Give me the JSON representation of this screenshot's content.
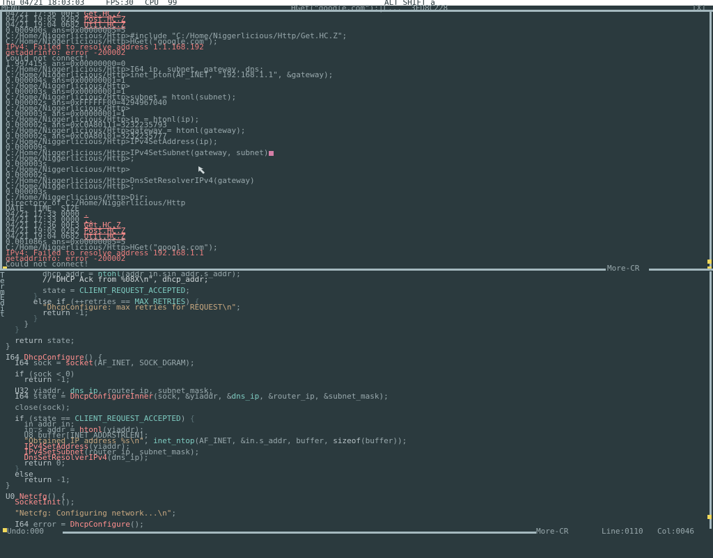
{
  "topbar": {
    "clock": "Thu 04/21 18:03:03",
    "fps": "FPS:30",
    "cpu": "CPU  99",
    "keystate": "ALT SHIFT a"
  },
  "titlebar": {
    "menu": "MENU",
    "title": "HGet(\"google.com\");|L...  3FD8C228",
    "close": "[X]"
  },
  "terminal": {
    "lines": [
      [
        {
          "c": "t-norm",
          "t": "04/21 17:36 00F3 "
        },
        {
          "c": "t-link",
          "t": "Get.HC.Z"
        }
      ],
      [
        {
          "c": "t-norm",
          "t": "04/21 19:05 02B2 "
        },
        {
          "c": "t-link",
          "t": "Post.HC.Z"
        }
      ],
      [
        {
          "c": "t-norm",
          "t": "04/21 19:04 0682 "
        },
        {
          "c": "t-link",
          "t": "Util.HC.Z"
        }
      ],
      [
        {
          "c": "t-norm",
          "t": "0.000900s ans=0x00000005=5"
        }
      ],
      [
        {
          "c": "t-norm",
          "t": "C:/Home/Niggerlicious/Http>#include \"C:/Home/Niggerlicious/Http/Get.HC.Z\";"
        }
      ],
      [
        {
          "c": "t-norm",
          "t": "C:/Home/Niggerlicious/Http>HGet(\"google.com\");"
        }
      ],
      [
        {
          "c": "t-err",
          "t": "IPv4: Failed to resolve address 1.1.168.192"
        }
      ],
      [
        {
          "c": "t-err",
          "t": "getaddrinfo: error -200002"
        }
      ],
      [
        {
          "c": "t-norm",
          "t": "Could not connect!"
        }
      ],
      [
        {
          "c": "t-norm",
          "t": "1.997415s ans=0x00000000=0"
        }
      ],
      [
        {
          "c": "t-norm",
          "t": "C:/Home/Niggerlicious/Http>I64 ip, subnet, gateway, dns;"
        }
      ],
      [
        {
          "c": "t-norm",
          "t": "C:/Home/Niggerlicious/Http>inet_pton(AF_INET, \"192.168.1.1\", &gateway);"
        }
      ],
      [
        {
          "c": "t-norm",
          "t": "0.000004s ans=0x00000001=1"
        }
      ],
      [
        {
          "c": "t-norm",
          "t": "C:/Home/Niggerlicious/Http>"
        }
      ],
      [
        {
          "c": "t-norm",
          "t": "0.000003s ans=0x00000001=1"
        }
      ],
      [
        {
          "c": "t-norm",
          "t": "C:/Home/Niggerlicious/Http>subnet = htonl(subnet);"
        }
      ],
      [
        {
          "c": "t-norm",
          "t": "0.000002s ans=0xFFFFFF00=4294967040"
        }
      ],
      [
        {
          "c": "t-norm",
          "t": "C:/Home/Niggerlicious/Http>"
        }
      ],
      [
        {
          "c": "t-norm",
          "t": "0.000003s ans=0x00000001=1"
        }
      ],
      [
        {
          "c": "t-norm",
          "t": "C:/Home/Niggerlicious/Http>ip = htonl(ip);"
        }
      ],
      [
        {
          "c": "t-norm",
          "t": "0.000002s ans=0xC0A80111=3232235793"
        }
      ],
      [
        {
          "c": "t-norm",
          "t": "C:/Home/Niggerlicious/Http>gateway = htonl(gateway);"
        }
      ],
      [
        {
          "c": "t-norm",
          "t": "0.000002s ans=0xC0A80101=3232235777"
        }
      ],
      [
        {
          "c": "t-norm",
          "t": "C:/Home/Niggerlicious/Http>IPv4SetAddress(ip);"
        }
      ],
      [
        {
          "c": "t-norm",
          "t": "0.000009s"
        }
      ],
      [
        {
          "c": "t-norm",
          "t": "C:/Home/Niggerlicious/Http>IPv4SetSubnet(gateway, subnet)"
        },
        {
          "c": "cursor",
          "t": ""
        }
      ],
      [
        {
          "c": "t-norm",
          "t": "C:/Home/Niggerlicious/Http>;"
        }
      ],
      [
        {
          "c": "t-norm",
          "t": "0.000003s"
        }
      ],
      [
        {
          "c": "t-norm",
          "t": "C:/Home/Niggerlicious/Http>"
        }
      ],
      [
        {
          "c": "t-norm",
          "t": "0.000002s"
        }
      ],
      [
        {
          "c": "t-norm",
          "t": "C:/Home/Niggerlicious/Http>DnsSetResolverIPv4(gateway)"
        }
      ],
      [
        {
          "c": "t-norm",
          "t": "C:/Home/Niggerlicious/Http>;"
        }
      ],
      [
        {
          "c": "t-norm",
          "t": "0.000003s"
        }
      ],
      [
        {
          "c": "t-norm",
          "t": "C:/Home/Niggerlicious/Http>Dir;"
        }
      ],
      [
        {
          "c": "t-norm",
          "t": "Directory of C:/Home/Niggerlicious/Http"
        }
      ],
      [
        {
          "c": "t-norm",
          "t": "DATE_ TIME_ SIZE"
        }
      ],
      [
        {
          "c": "t-norm",
          "t": "04/21 17:33 0000 "
        },
        {
          "c": "t-link",
          "t": "."
        }
      ],
      [
        {
          "c": "t-norm",
          "t": "04/21 17:33 0000 "
        },
        {
          "c": "t-link",
          "t": ".."
        }
      ],
      [
        {
          "c": "t-norm",
          "t": "04/21 17:36 00F3 "
        },
        {
          "c": "t-link",
          "t": "Get.HC.Z"
        }
      ],
      [
        {
          "c": "t-norm",
          "t": "04/21 19:05 02B2 "
        },
        {
          "c": "t-link",
          "t": "Post.HC.Z"
        }
      ],
      [
        {
          "c": "t-norm",
          "t": "04/21 19:04 0682 "
        },
        {
          "c": "t-link",
          "t": "Util.HC.Z"
        }
      ],
      [
        {
          "c": "t-norm",
          "t": "0.001086s ans=0x00000005=5"
        }
      ],
      [
        {
          "c": "t-norm",
          "t": "C:/Home/Niggerlicious/Http>HGet(\"google.com\");"
        }
      ],
      [
        {
          "c": "t-err",
          "t": "IPv4: Failed to resolve address 192.168.1.1"
        }
      ],
      [
        {
          "c": "t-err",
          "t": "getaddrinfo: error -200002"
        }
      ],
      [
        {
          "c": "t-norm",
          "t": "Could not connect!"
        }
      ]
    ]
  },
  "more_cr_top": "More-CR",
  "editor_side": "T e r m E d i t",
  "editor": {
    "lines": [
      [
        {
          "c": "",
          "t": "        dhcp_addr = "
        },
        {
          "c": "id",
          "t": "ntohl"
        },
        {
          "c": "",
          "t": "(addr_in.sin_addr.s_addr);"
        }
      ],
      [
        {
          "c": "com",
          "t": "        //\"DHCP Ack from %08X\\n\", dhcp_addr;"
        }
      ],
      [
        {
          "c": "",
          "t": ""
        }
      ],
      [
        {
          "c": "",
          "t": "        state = "
        },
        {
          "c": "id",
          "t": "CLIENT_REQUEST_ACCEPTED"
        },
        {
          "c": "",
          "t": ";"
        }
      ],
      [
        {
          "c": "dim",
          "t": "      }"
        }
      ],
      [
        {
          "c": "",
          "t": "      "
        },
        {
          "c": "kw",
          "t": "else if"
        },
        {
          "c": "",
          "t": " (++retries == "
        },
        {
          "c": "id",
          "t": "MAX_RETRIES"
        },
        {
          "c": "",
          "t": ") "
        },
        {
          "c": "dim",
          "t": "{"
        }
      ],
      [
        {
          "c": "str",
          "t": "        \"DhcpConfigure: max retries for REQUEST\\n\""
        },
        {
          "c": "",
          "t": ";"
        }
      ],
      [
        {
          "c": "",
          "t": "        "
        },
        {
          "c": "kw",
          "t": "return"
        },
        {
          "c": "",
          "t": " -1;"
        }
      ],
      [
        {
          "c": "dim",
          "t": "      }"
        }
      ],
      [
        {
          "c": "",
          "t": "    }"
        }
      ],
      [
        {
          "c": "dim",
          "t": "  }"
        }
      ],
      [
        {
          "c": "",
          "t": ""
        }
      ],
      [
        {
          "c": "",
          "t": "  "
        },
        {
          "c": "kw",
          "t": "return"
        },
        {
          "c": "",
          "t": " state;"
        }
      ],
      [
        {
          "c": "",
          "t": "}"
        }
      ],
      [
        {
          "c": "",
          "t": ""
        }
      ],
      [
        {
          "c": "ty",
          "t": "I64 "
        },
        {
          "c": "fn",
          "t": "DhcpConfigure"
        },
        {
          "c": "",
          "t": "() {"
        }
      ],
      [
        {
          "c": "ty",
          "t": "  I64"
        },
        {
          "c": "",
          "t": " sock = "
        },
        {
          "c": "fn",
          "t": "socket"
        },
        {
          "c": "",
          "t": "(AF_INET, SOCK_DGRAM);"
        }
      ],
      [
        {
          "c": "",
          "t": ""
        }
      ],
      [
        {
          "c": "",
          "t": "  "
        },
        {
          "c": "kw",
          "t": "if"
        },
        {
          "c": "",
          "t": " (sock < 0)"
        }
      ],
      [
        {
          "c": "",
          "t": "    "
        },
        {
          "c": "kw",
          "t": "return"
        },
        {
          "c": "",
          "t": " -1;"
        }
      ],
      [
        {
          "c": "",
          "t": ""
        }
      ],
      [
        {
          "c": "ty",
          "t": "  U32"
        },
        {
          "c": "",
          "t": " yiaddr, "
        },
        {
          "c": "id",
          "t": "dns_ip"
        },
        {
          "c": "",
          "t": ", router_ip, subnet_mask;"
        }
      ],
      [
        {
          "c": "ty",
          "t": "  I64"
        },
        {
          "c": "",
          "t": " state = "
        },
        {
          "c": "fn",
          "t": "DhcpConfigureInner"
        },
        {
          "c": "",
          "t": "(sock, &yiaddr, &"
        },
        {
          "c": "id",
          "t": "dns_ip"
        },
        {
          "c": "",
          "t": ", &router_ip, &subnet_mask);"
        }
      ],
      [
        {
          "c": "",
          "t": ""
        }
      ],
      [
        {
          "c": "",
          "t": "  close(sock);"
        }
      ],
      [
        {
          "c": "",
          "t": ""
        }
      ],
      [
        {
          "c": "",
          "t": "  "
        },
        {
          "c": "kw",
          "t": "if"
        },
        {
          "c": "",
          "t": " (state == "
        },
        {
          "c": "id",
          "t": "CLIENT_REQUEST_ACCEPTED"
        },
        {
          "c": "",
          "t": ") "
        },
        {
          "c": "dim",
          "t": "{"
        }
      ],
      [
        {
          "c": "",
          "t": "    in_addr in;"
        }
      ],
      [
        {
          "c": "",
          "t": "    in.s_addr = "
        },
        {
          "c": "fn",
          "t": "htonl"
        },
        {
          "c": "",
          "t": "(yiaddr);"
        }
      ],
      [
        {
          "c": "",
          "t": "    U8 buffer[INET_ADDRSTRLEN];"
        }
      ],
      [
        {
          "c": "str",
          "t": "    \"Obtained IP address %s\\n\""
        },
        {
          "c": "",
          "t": ", "
        },
        {
          "c": "id",
          "t": "inet_ntop"
        },
        {
          "c": "",
          "t": "(AF_INET, &in.s_addr, buffer, "
        },
        {
          "c": "kw",
          "t": "sizeof"
        },
        {
          "c": "",
          "t": "(buffer));"
        }
      ],
      [
        {
          "c": "fn",
          "t": "    IPv4SetAddress"
        },
        {
          "c": "",
          "t": "(yiaddr);"
        }
      ],
      [
        {
          "c": "fn",
          "t": "    IPv4SetSubnet"
        },
        {
          "c": "",
          "t": "(router_ip, subnet_mask);"
        }
      ],
      [
        {
          "c": "fn",
          "t": "    DnsSetResolverIPv4"
        },
        {
          "c": "",
          "t": "(dns_ip);"
        }
      ],
      [
        {
          "c": "",
          "t": "    "
        },
        {
          "c": "kw",
          "t": "return"
        },
        {
          "c": "",
          "t": " 0;"
        }
      ],
      [
        {
          "c": "dim",
          "t": "  }"
        }
      ],
      [
        {
          "c": "",
          "t": "  "
        },
        {
          "c": "kw",
          "t": "else"
        }
      ],
      [
        {
          "c": "",
          "t": "    "
        },
        {
          "c": "kw",
          "t": "return"
        },
        {
          "c": "",
          "t": " -1;"
        }
      ],
      [
        {
          "c": "",
          "t": "}"
        }
      ],
      [
        {
          "c": "",
          "t": ""
        }
      ],
      [
        {
          "c": "ty",
          "t": "U0 "
        },
        {
          "c": "fn",
          "t": "Netcfg"
        },
        {
          "c": "",
          "t": "() {"
        }
      ],
      [
        {
          "c": "fn",
          "t": "  SocketInit"
        },
        {
          "c": "",
          "t": "();"
        }
      ],
      [
        {
          "c": "",
          "t": ""
        }
      ],
      [
        {
          "c": "str",
          "t": "  \"Netcfg: Configuring network...\\n\""
        },
        {
          "c": "",
          "t": ";"
        }
      ],
      [
        {
          "c": "",
          "t": ""
        }
      ],
      [
        {
          "c": "ty",
          "t": "  I64"
        },
        {
          "c": "",
          "t": " error = "
        },
        {
          "c": "fn",
          "t": "DhcpConfigure"
        },
        {
          "c": "",
          "t": "();"
        }
      ]
    ]
  },
  "status": {
    "undo": "Undo:000",
    "more": "More-CR",
    "line": "Line:0110",
    "col": "Col:0046"
  },
  "colors": {
    "background": "#2b3a3e",
    "frame": "#a5b9bf",
    "error_text": "#e87e7e",
    "cursor": "#d47ea6",
    "corner": "#f1d95b"
  }
}
